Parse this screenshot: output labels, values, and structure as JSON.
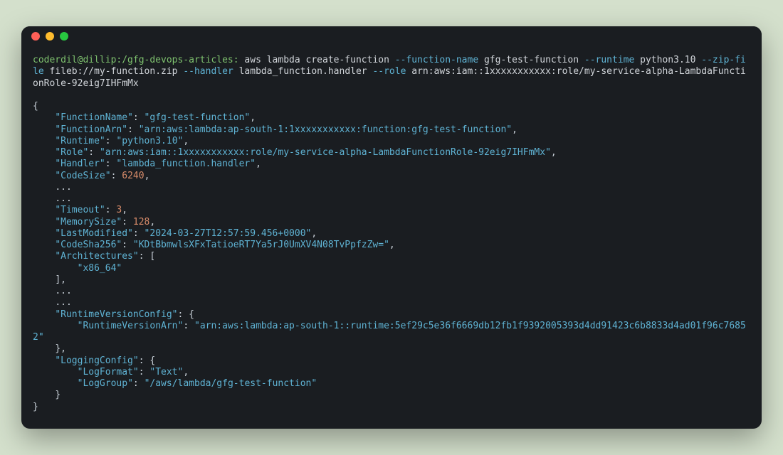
{
  "prompt": "coderdil@dillip:/gfg-devops-articles:",
  "cmd": {
    "base": "aws lambda create-function",
    "flag1": "--function-name",
    "arg1": "gfg-test-function",
    "flag2": "--runtime",
    "arg2": "python3.10",
    "flag3": "--zip-file",
    "arg3": "fileb://my-function.zip",
    "flag4": "--handler",
    "arg4": "lambda_function.handler",
    "flag5": "--role",
    "arg5": "arn:aws:iam::1xxxxxxxxxxx:role/my-service-alpha-LambdaFunctionRole-92eig7IHFmMx"
  },
  "out": {
    "open": "{",
    "k_FunctionName": "\"FunctionName\"",
    "v_FunctionName": "\"gfg-test-function\"",
    "k_FunctionArn": "\"FunctionArn\"",
    "v_FunctionArn": "\"arn:aws:lambda:ap-south-1:1xxxxxxxxxxx:function:gfg-test-function\"",
    "k_Runtime": "\"Runtime\"",
    "v_Runtime": "\"python3.10\"",
    "k_Role": "\"Role\"",
    "v_Role": "\"arn:aws:iam::1xxxxxxxxxxx:role/my-service-alpha-LambdaFunctionRole-92eig7IHFmMx\"",
    "k_Handler": "\"Handler\"",
    "v_Handler": "\"lambda_function.handler\"",
    "k_CodeSize": "\"CodeSize\"",
    "v_CodeSize": "6240",
    "ell": "...",
    "k_Timeout": "\"Timeout\"",
    "v_Timeout": "3",
    "k_MemorySize": "\"MemorySize\"",
    "v_MemorySize": "128",
    "k_LastModified": "\"LastModified\"",
    "v_LastModified": "\"2024-03-27T12:57:59.456+0000\"",
    "k_CodeSha256": "\"CodeSha256\"",
    "v_CodeSha256": "\"KDtBbmwlsXFxTatioeRT7Ya5rJ0UmXV4N08TvPpfzZw=\"",
    "k_Architectures": "\"Architectures\"",
    "arch_open": "[",
    "arch_val": "\"x86_64\"",
    "arch_close": "]",
    "k_RuntimeVersionConfig": "\"RuntimeVersionConfig\"",
    "k_RuntimeVersionArn": "\"RuntimeVersionArn\"",
    "v_RuntimeVersionArn": "\"arn:aws:lambda:ap-south-1::runtime:5ef29c5e36f6669db12fb1f9392005393d4dd91423c6b8833d4ad01f96c76852\"",
    "k_LoggingConfig": "\"LoggingConfig\"",
    "k_LogFormat": "\"LogFormat\"",
    "v_LogFormat": "\"Text\"",
    "k_LogGroup": "\"LogGroup\"",
    "v_LogGroup": "\"/aws/lambda/gfg-test-function\"",
    "close": "}"
  }
}
